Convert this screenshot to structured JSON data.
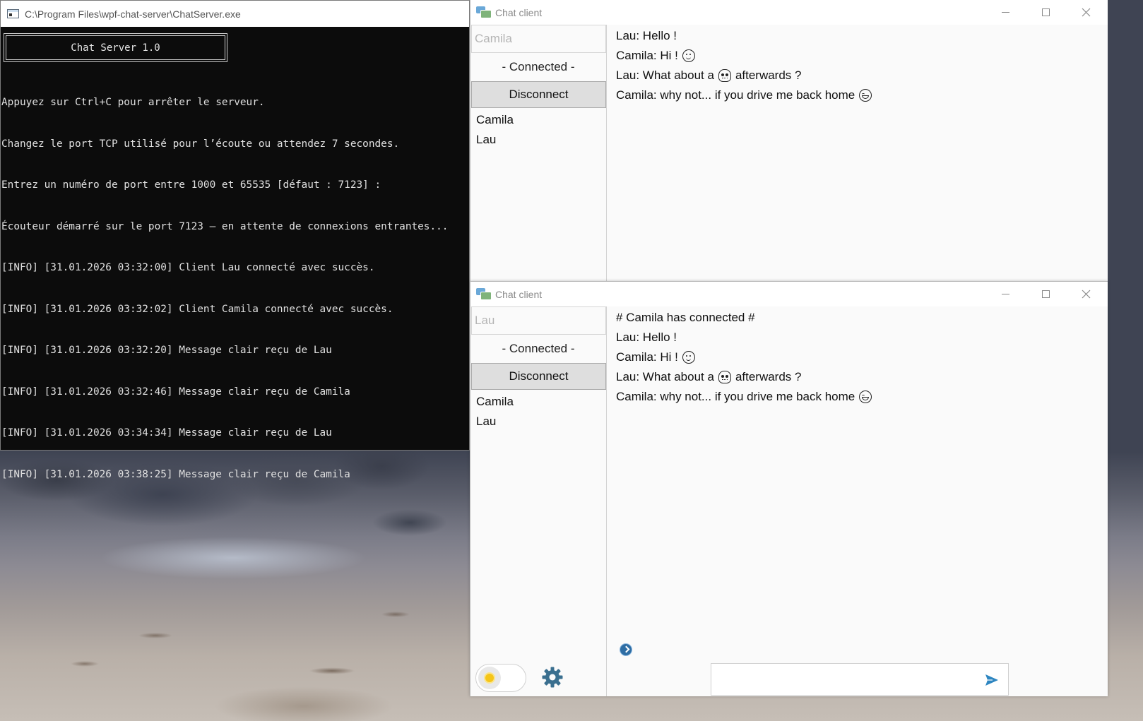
{
  "console": {
    "window_title": "C:\\Program Files\\wpf-chat-server\\ChatServer.exe",
    "banner": "Chat Server 1.0",
    "lines": [
      "Appuyez sur Ctrl+C pour arrêter le serveur.",
      "Changez le port TCP utilisé pour l’écoute ou attendez 7 secondes.",
      "Entrez un numéro de port entre 1000 et 65535 [défaut : 7123] :",
      "Écouteur démarré sur le port 7123 — en attente de connexions entrantes...",
      "[INFO] [31.01.2026 03:32:00] Client Lau connecté avec succès.",
      "[INFO] [31.01.2026 03:32:02] Client Camila connecté avec succès.",
      "[INFO] [31.01.2026 03:32:20] Message clair reçu de Lau",
      "[INFO] [31.01.2026 03:32:46] Message clair reçu de Camila",
      "[INFO] [31.01.2026 03:34:34] Message clair reçu de Lau",
      "[INFO] [31.01.2026 03:38:25] Message clair reçu de Camila"
    ]
  },
  "chat1": {
    "window_title": "Chat client",
    "username_value": "Camila",
    "status": "- Connected -",
    "disconnect_label": "Disconnect",
    "users": [
      "Camila",
      "Lau"
    ],
    "messages": [
      {
        "text": "Lau: Hello !",
        "emoji": null,
        "after": ""
      },
      {
        "text": "Camila: Hi !",
        "emoji": "smile",
        "after": ""
      },
      {
        "text": "Lau: What about a",
        "emoji": "skull",
        "after": "afterwards ?"
      },
      {
        "text": "Camila: why not... if you drive me back home",
        "emoji": "grin",
        "after": ""
      }
    ]
  },
  "chat2": {
    "window_title": "Chat client",
    "username_value": "Lau",
    "status": "- Connected -",
    "disconnect_label": "Disconnect",
    "users": [
      "Camila",
      "Lau"
    ],
    "messages": [
      {
        "text": "# Camila has connected #",
        "emoji": null,
        "after": ""
      },
      {
        "text": "Lau: Hello !",
        "emoji": null,
        "after": ""
      },
      {
        "text": "Camila: Hi !",
        "emoji": "smile",
        "after": ""
      },
      {
        "text": "Lau: What about a",
        "emoji": "skull",
        "after": "afterwards ?"
      },
      {
        "text": "Camila: why not... if you drive me back home",
        "emoji": "grin",
        "after": ""
      }
    ],
    "message_input_value": "",
    "icons": {
      "theme_toggle": "sun-icon",
      "settings": "gear-icon",
      "send": "send-icon",
      "scroll": "chevron-right-icon"
    }
  },
  "colors": {
    "console_bg": "#0c0c0c",
    "console_text": "#e0e0e0",
    "chat_bg": "#fafafa",
    "button_bg": "#dedede",
    "accent": "#2e86c1",
    "sun": "#f5c518"
  }
}
